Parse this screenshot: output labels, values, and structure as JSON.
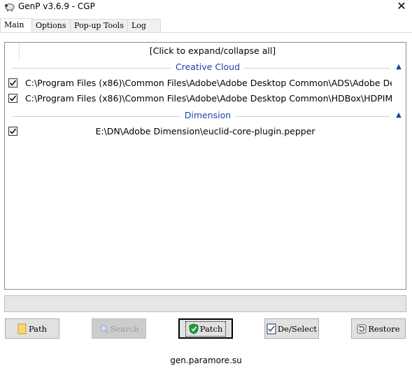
{
  "window": {
    "title": "GenP v3.6.9 - CGP",
    "close_glyph": "✕"
  },
  "tabs": [
    {
      "label": "Main",
      "active": true
    },
    {
      "label": "Options",
      "active": false
    },
    {
      "label": "Pop-up Tools",
      "active": false
    },
    {
      "label": "Log",
      "active": false
    }
  ],
  "list": {
    "expand_label": "[Click to expand/collapse all]",
    "groups": [
      {
        "name": "Creative Cloud",
        "items": [
          {
            "checked": true,
            "path": "C:\\Program Files (x86)\\Common Files\\Adobe\\Adobe Desktop Common\\ADS\\Adobe De..."
          },
          {
            "checked": true,
            "path": "C:\\Program Files (x86)\\Common Files\\Adobe\\Adobe Desktop Common\\HDBox\\HDPIM...."
          }
        ]
      },
      {
        "name": "Dimension",
        "items": [
          {
            "checked": true,
            "path": "E:\\DN\\Adobe Dimension\\euclid-core-plugin.pepper"
          }
        ]
      }
    ]
  },
  "progress": {
    "value": 0
  },
  "buttons": {
    "path": "Path",
    "search": "Search",
    "patch": "Patch",
    "deselect": "De/Select",
    "restore": "Restore"
  },
  "footer": {
    "link": "gen.paramore.su"
  },
  "colors": {
    "group_accent": "#1e3fa8",
    "patch_shield": "#1a9b3c"
  },
  "icons": {
    "app": "sheep-icon",
    "close": "close-icon",
    "path": "folder-icon",
    "search": "magnifier-icon",
    "patch": "shield-check-icon",
    "deselect": "checklist-icon",
    "restore": "restore-icon",
    "collapse": "chevron-up-icon"
  }
}
